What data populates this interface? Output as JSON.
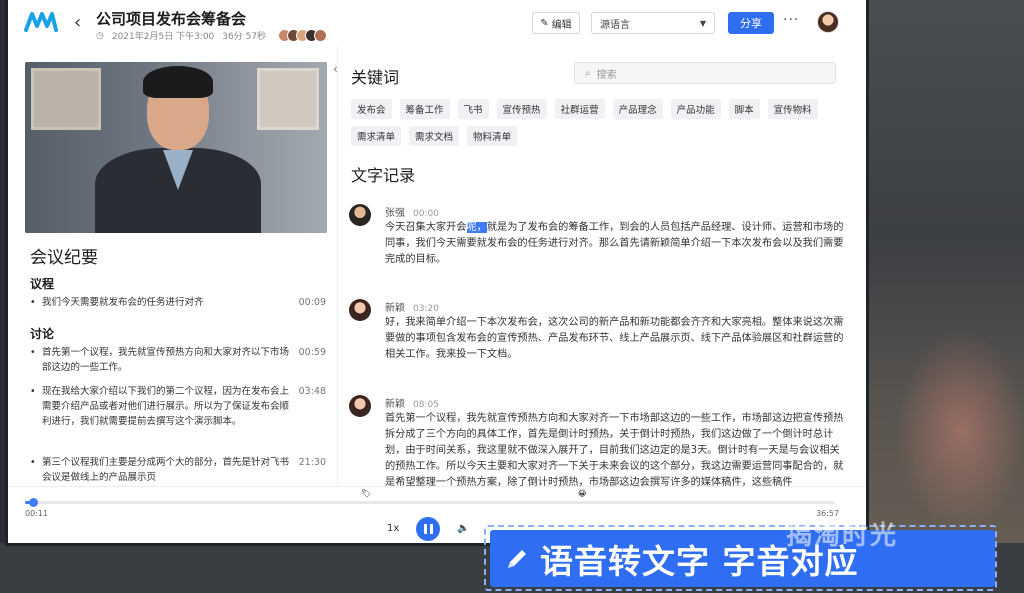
{
  "header": {
    "title": "公司项目发布会筹备会",
    "date": "2021年2月5日 下午3:00",
    "duration": "36分 57秒",
    "edit_label": "编辑",
    "language_label": "源语言",
    "share_label": "分享",
    "more_label": "···"
  },
  "left": {
    "summary_title": "会议纪要",
    "agenda_title": "议程",
    "agenda_items": [
      {
        "text": "我们今天需要就发布会的任务进行对齐",
        "time": "00:09"
      }
    ],
    "discussion_title": "讨论",
    "discussion_items": [
      {
        "text": "首先第一个议程，我先就宣传预热方向和大家对齐以下市场部这边的一些工作。",
        "time": "00:59"
      },
      {
        "text": "现在我给大家介绍以下我们的第二个议程，因为在发布会上需要介绍产品或者对他们进行展示。所以为了保证发布会顺利进行，我们就需要提前去撰写这个演示脚本。",
        "time": "03:48"
      },
      {
        "text": "第三个议程我们主要是分成两个大的部分，首先是针对飞书会议是做线上的产品展示页",
        "time": "21:30"
      }
    ]
  },
  "right": {
    "keywords_title": "关键词",
    "search_placeholder": "搜索",
    "tags": [
      "发布会",
      "筹备工作",
      "飞书",
      "宣传预热",
      "社群运营",
      "产品理念",
      "产品功能",
      "脚本",
      "宣传物料",
      "需求清单",
      "需求文档",
      "物料清单"
    ],
    "transcript_title": "文字记录",
    "entries": [
      {
        "name": "张强",
        "time": "00:00",
        "pre": "今天召集大家开会",
        "highlight": "呢，",
        "post": "就是为了发布会的筹备工作，到会的人员包括产品经理、设计师、运营和市场的同事，我们今天需要就发布会的任务进行对齐。那么首先请新颖简单介绍一下本次发布会以及我们需要完成的目标。"
      },
      {
        "name": "新颖",
        "time": "03:20",
        "pre": "好，我来简单介绍一下本次发布会，这次公司的新产品和新功能都会齐齐和大家亮相。整体来说这次需要做的事项包含发布会的宣传预热、产品发布环节、线上产品展示页、线下产品体验展区和社群运营的相关工作。我来投一下文档。",
        "highlight": "",
        "post": ""
      },
      {
        "name": "新颖",
        "time": "08:05",
        "pre": "首先第一个议程，我先就宣传预热方向和大家对齐一下市场部这边的一些工作，市场部这边把宣传预热拆分成了三个方向的具体工作，首先是倒计时预热，关于倒计时预热，我们这边做了一个倒计时总计划，由于时间关系，我这里就不做深入展开了，目前我们这边定的是3天。倒计时有一天是与会议相关的预热工作。所以今天主要和大家对齐一下关于未来会议的这个部分，我这边需要运营同事配合的，就是希望整理一个预热方案，除了倒计时预热，市场部这边会撰写许多的媒体稿件，这些稿件",
        "highlight": "",
        "post": ""
      }
    ]
  },
  "player": {
    "current_time": "00:11",
    "total_time": "36:57",
    "speed": "1x",
    "progress": 0.005
  },
  "caption": {
    "text": "语音转文字 字音对应",
    "watermark": "揭淘时光"
  },
  "colors": {
    "accent": "#2e6ff2",
    "highlight": "#3d7bf7"
  }
}
